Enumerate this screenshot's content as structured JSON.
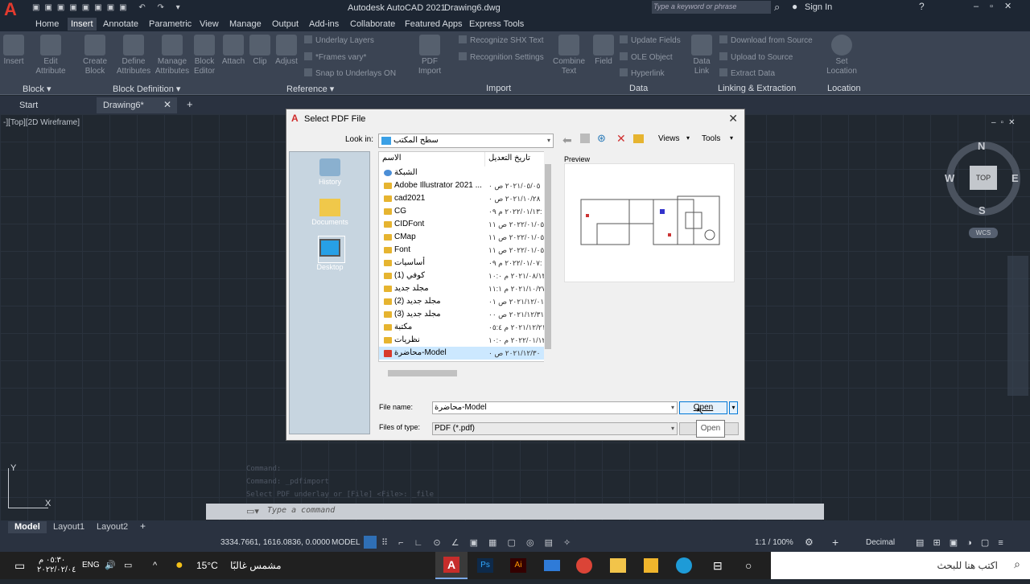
{
  "app": {
    "title": "Autodesk AutoCAD 2021",
    "file": "Drawing6.dwg",
    "search_placeholder": "Type a keyword or phrase",
    "sign_in": "Sign In"
  },
  "ribbon_tabs": [
    "Home",
    "Insert",
    "Annotate",
    "Parametric",
    "View",
    "Manage",
    "Output",
    "Add-ins",
    "Collaborate",
    "Featured Apps",
    "Express Tools"
  ],
  "active_ribbon_tab": "Insert",
  "ribbon": {
    "block": {
      "insert": "Insert",
      "edit_attribute": "Edit Attribute",
      "panel": "Block ▾"
    },
    "block_def": {
      "create": "Create Block",
      "define": "Define Attributes",
      "manage": "Manage Attributes",
      "editor": "Block Editor",
      "panel": "Block Definition ▾"
    },
    "reference": {
      "attach": "Attach",
      "clip": "Clip",
      "adjust": "Adjust",
      "underlay": "Underlay Layers",
      "frames": "*Frames vary*",
      "snap": "Snap to Underlays ON",
      "panel": "Reference ▾"
    },
    "import": {
      "pdf": "PDF Import",
      "recognize": "Recognize SHX Text",
      "settings": "Recognition Settings",
      "combine": "Combine Text",
      "panel": "Import"
    },
    "data": {
      "field": "Field",
      "update": "Update Fields",
      "ole": "OLE Object",
      "hyperlink": "Hyperlink",
      "panel": "Data"
    },
    "linking": {
      "datalink": "Data Link",
      "download": "Download from Source",
      "upload": "Upload to Source",
      "extract": "Extract Data",
      "panel": "Linking & Extraction"
    },
    "location": {
      "set": "Set Location",
      "panel": "Location"
    }
  },
  "doc_tabs": [
    "Start",
    "Drawing6*"
  ],
  "viewport_label": "-][Top][2D Wireframe]",
  "viewcube": {
    "n": "N",
    "s": "S",
    "e": "E",
    "w": "W",
    "top": "TOP",
    "wcs": "WCS"
  },
  "command_history": [
    "Command:",
    "Command: _pdfimport",
    "Select PDF underlay or [File] <File>: _file"
  ],
  "command_placeholder": "Type a command",
  "layout_tabs": [
    "Model",
    "Layout1",
    "Layout2"
  ],
  "status": {
    "coords": "3334.7661, 1616.0836, 0.0000",
    "model": "MODEL",
    "scale": "1:1 / 100%",
    "units": "Decimal"
  },
  "dialog": {
    "title": "Select PDF File",
    "look_in_label": "Look in:",
    "look_in_value": "سطح المكتب",
    "views": "Views",
    "tools": "Tools",
    "places": [
      "History",
      "Documents",
      "Desktop"
    ],
    "col_name": "الاسم",
    "col_date": "تاريخ التعديل",
    "files": [
      {
        "name": "الشبكة",
        "date": ""
      },
      {
        "name": "Adobe Illustrator 2021 ...",
        "date": "٢٠٢١/٠٥/٠٥ ص ٠"
      },
      {
        "name": "cad2021",
        "date": "٢٠٢١/١٠/٢٨ ص ٠"
      },
      {
        "name": "CG",
        "date": "٢٠٢٢/٠١/١٣ م ٠٩:"
      },
      {
        "name": "CIDFont",
        "date": "٢٠٢٢/٠١/٠٥ ص ١١"
      },
      {
        "name": "CMap",
        "date": "٢٠٢٢/٠١/٠٥ ص ١١"
      },
      {
        "name": "Font",
        "date": "٢٠٢٢/٠١/٠٥ ص ١١"
      },
      {
        "name": "أساسيات",
        "date": "٢٠٢٢/٠١/٠٧ م ٠٩:"
      },
      {
        "name": "كوفي (1)",
        "date": "٢٠٢١/٠٨/١٣ م ١٠:٠"
      },
      {
        "name": "مجلد جديد",
        "date": "٢٠٢١/١٠/٢٧ م ١١:١"
      },
      {
        "name": "مجلد جديد (2)",
        "date": "٢٠٢١/١٢/٠١ ص ٠١:"
      },
      {
        "name": "مجلد جديد (3)",
        "date": "٢٠٢١/١٢/٣١ ص ٠٠"
      },
      {
        "name": "مكتبة",
        "date": "٢٠٢١/١٢/٢١ م ٠٥:٤"
      },
      {
        "name": "نظريات",
        "date": "٢٠٢٢/٠١/١٢ م ١٠:٠"
      },
      {
        "name": "محاضرة-Model",
        "date": "٢٠٢١/١٢/٣٠ ص ٠"
      }
    ],
    "preview_label": "Preview",
    "file_name_label": "File name:",
    "file_name_value": "محاضرة-Model",
    "files_of_type_label": "Files of type:",
    "files_of_type_value": "PDF (*.pdf)",
    "open": "Open",
    "tooltip": "Open"
  },
  "taskbar": {
    "search": "اكتب هنا للبحث",
    "weather": "مشمس غالبًا",
    "temp": "15°C",
    "lang": "ENG",
    "time": "٠٥:٣٠ م",
    "date": "٢٠٢٢/٠٢/٠٤"
  }
}
